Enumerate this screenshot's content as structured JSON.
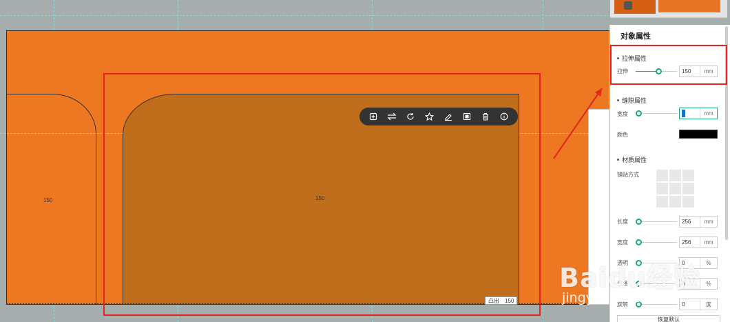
{
  "canvas": {
    "dimension_left": "150",
    "dimension_center": "150",
    "extrude_tag": {
      "label": "凸出",
      "value": "150"
    }
  },
  "toolbar": {
    "items": [
      {
        "name": "copy-icon",
        "glyph": "⊞"
      },
      {
        "name": "swap-icon",
        "glyph": "⇌"
      },
      {
        "name": "rotate-icon",
        "glyph": "↻"
      },
      {
        "name": "favorite-icon",
        "glyph": "☆"
      },
      {
        "name": "eraser-icon",
        "glyph": "⌫"
      },
      {
        "name": "frame-icon",
        "glyph": "▣"
      },
      {
        "name": "trash-icon",
        "glyph": "🗑"
      },
      {
        "name": "info-icon",
        "glyph": "ⓘ"
      }
    ]
  },
  "panel": {
    "title": "对象属性",
    "stretch": {
      "section": "拉伸属性",
      "label": "拉伸",
      "value": "150",
      "unit": "mm",
      "slider_fraction": 0.55
    },
    "gap": {
      "section": "缝隙属性",
      "width_label": "宽度",
      "width_value": "",
      "unit": "mm",
      "color_label": "颜色",
      "color": "#000000"
    },
    "material": {
      "section": "材质属性",
      "tile_label": "铺贴方式",
      "length_label": "长度",
      "length_value": "256",
      "width_label": "宽度",
      "width_value": "256",
      "unit": "mm",
      "row3_label": "透明",
      "row3_value": "0",
      "row3_unit": "%",
      "row4_label": "光泽",
      "row4_value": "0",
      "row4_unit": "%",
      "rotate_label": "旋转",
      "rotate_value": "0",
      "rotate_unit": "度"
    },
    "bottom_button": "恢复默认"
  },
  "watermark": {
    "main": "Baidu经验",
    "sub": "jingyan.baidu.com"
  },
  "colors": {
    "board": "#ee7722",
    "selected_panel": "#c06d1c",
    "accent": "#1aa880",
    "highlight": "#e5241d"
  }
}
